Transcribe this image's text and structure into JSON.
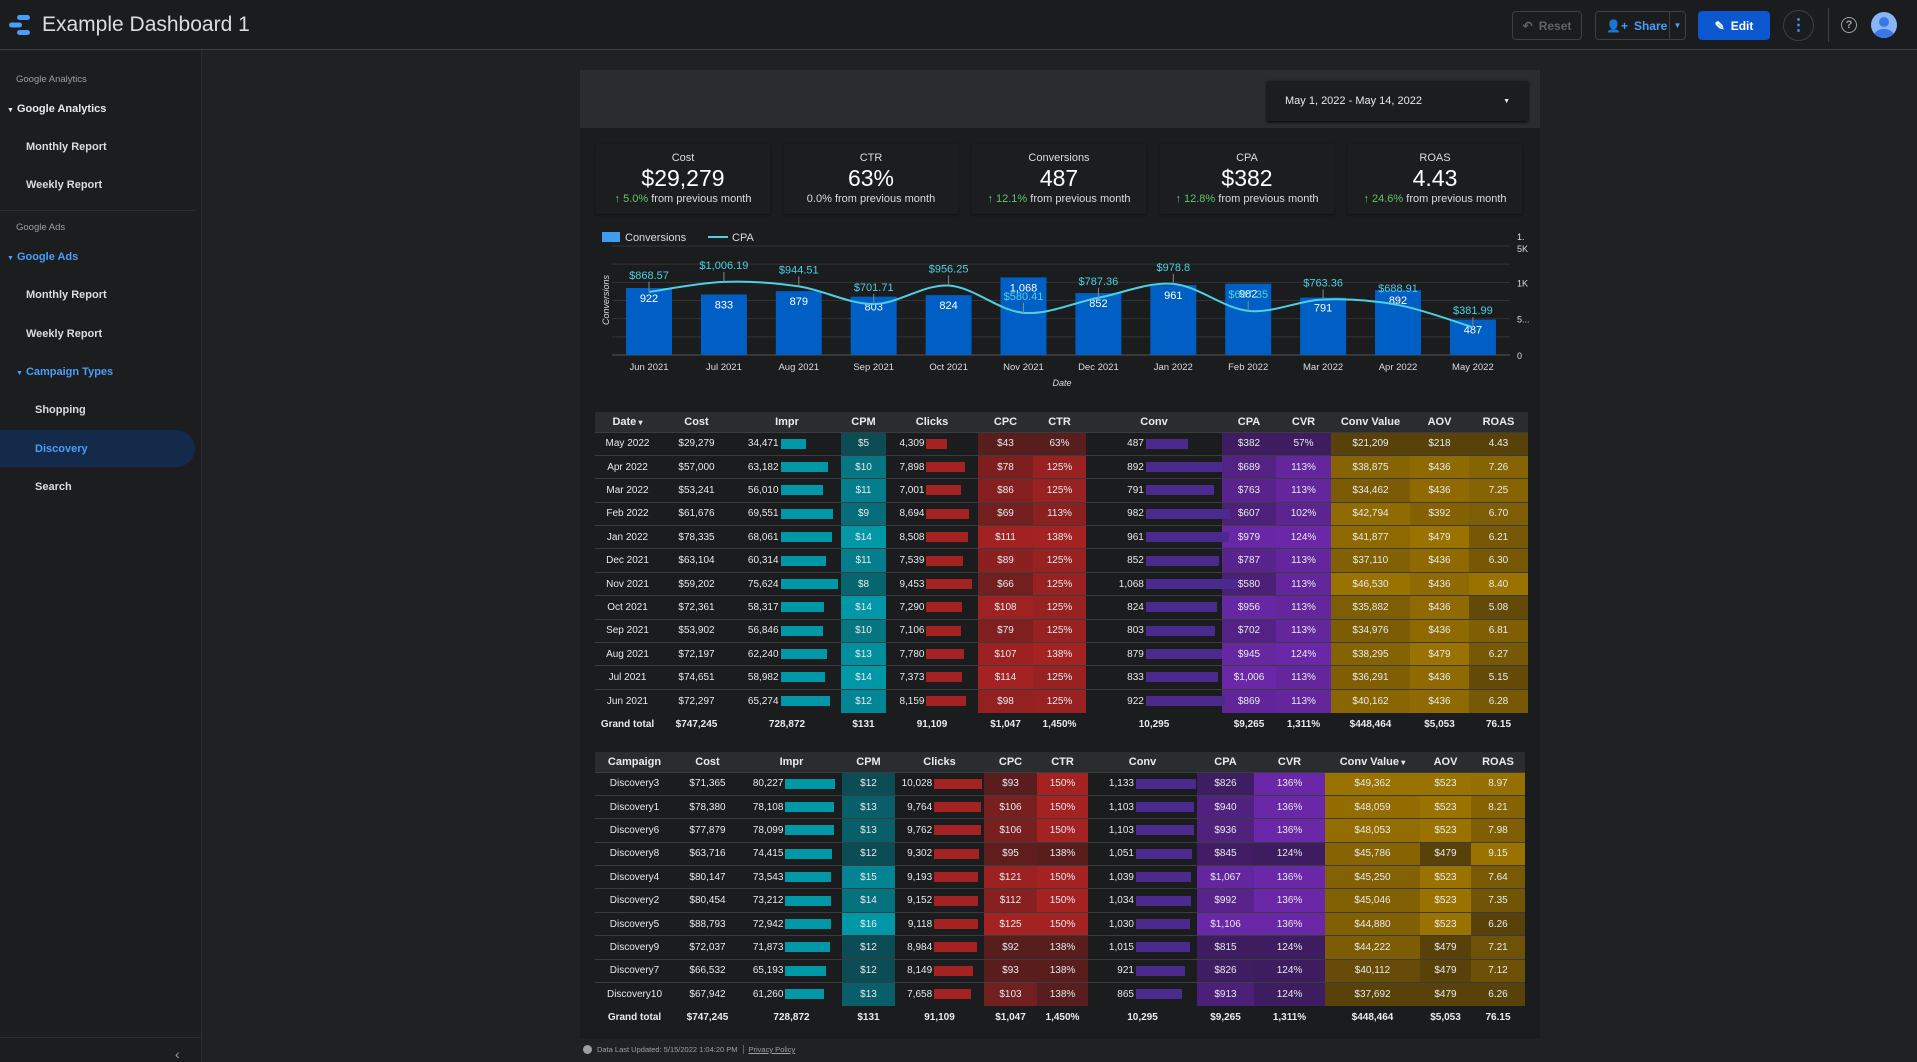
{
  "app": {
    "title": "Example Dashboard 1"
  },
  "toolbar": {
    "reset": "Reset",
    "share": "Share",
    "edit": "Edit"
  },
  "sidebar": {
    "ga_section": "Google Analytics",
    "ga_group": "Google Analytics",
    "ga_monthly": "Monthly Report",
    "ga_weekly": "Weekly Report",
    "ads_section": "Google Ads",
    "ads_group": "Google Ads",
    "ads_monthly": "Monthly Report",
    "ads_weekly": "Weekly Report",
    "campaign_types": "Campaign Types",
    "shopping": "Shopping",
    "discovery": "Discovery",
    "search": "Search"
  },
  "date_range": "May 1, 2022 - May 14, 2022",
  "kpis": [
    {
      "label": "Cost",
      "value": "$29,279",
      "delta": "5.0%",
      "suffix": "from previous month",
      "up": true
    },
    {
      "label": "CTR",
      "value": "63%",
      "delta": "0.0%",
      "suffix": "from previous month",
      "up": false
    },
    {
      "label": "Conversions",
      "value": "487",
      "delta": "12.1%",
      "suffix": "from previous month",
      "up": true
    },
    {
      "label": "CPA",
      "value": "$382",
      "delta": "12.8%",
      "suffix": "from previous month",
      "up": true
    },
    {
      "label": "ROAS",
      "value": "4.43",
      "delta": "24.6%",
      "suffix": "from previous month",
      "up": true
    }
  ],
  "chart_data": {
    "type": "bar",
    "categories": [
      "Jun 2021",
      "Jul 2021",
      "Aug 2021",
      "Sep 2021",
      "Oct 2021",
      "Nov 2021",
      "Dec 2021",
      "Jan 2022",
      "Feb 2022",
      "Mar 2022",
      "Apr 2022",
      "May 2022"
    ],
    "series": [
      {
        "name": "Conversions",
        "type": "bar",
        "values": [
          922,
          833,
          879,
          803,
          824,
          1068,
          852,
          961,
          982,
          791,
          892,
          487
        ],
        "labels": [
          "922",
          "833",
          "879",
          "803",
          "824",
          "1,068",
          "852",
          "961",
          "982",
          "791",
          "892",
          "487"
        ]
      },
      {
        "name": "CPA",
        "type": "line",
        "values": [
          868.57,
          1006.19,
          944.51,
          701.71,
          956.25,
          580.41,
          787.36,
          978.8,
          607.35,
          763.36,
          688.91,
          381.99
        ],
        "labels": [
          "$868.57",
          "$1,006.19",
          "$944.51",
          "$701.71",
          "$956.25",
          "$580.41",
          "$787.36",
          "$978.8",
          "$607.35",
          "$763.36",
          "$688.91",
          "$381.99"
        ]
      }
    ],
    "xlabel": "Date",
    "ylabel": "Conversions",
    "ylim": [
      0,
      1500
    ],
    "yticks": [
      "0",
      "5...",
      "1K",
      "1.\n5K"
    ],
    "colors": {
      "bar": "#005fc4",
      "legend_bar": "#3d9df0",
      "line": "#4dd0e1"
    },
    "legend": "top-left"
  },
  "table_monthly": {
    "headers": [
      "Date",
      "Cost",
      "Impr",
      "CPM",
      "Clicks",
      "CPC",
      "CTR",
      "Conv",
      "CPA",
      "CVR",
      "Conv Value",
      "AOV",
      "ROAS"
    ],
    "sort_col": 0,
    "rows": [
      [
        "May 2022",
        "$29,279",
        "34,471",
        "$5",
        "4,309",
        "$43",
        "63%",
        "487",
        "$382",
        "57%",
        "$21,209",
        "$218",
        "4.43"
      ],
      [
        "Apr 2022",
        "$57,000",
        "63,182",
        "$10",
        "7,898",
        "$78",
        "125%",
        "892",
        "$689",
        "113%",
        "$38,875",
        "$436",
        "7.26"
      ],
      [
        "Mar 2022",
        "$53,241",
        "56,010",
        "$11",
        "7,001",
        "$86",
        "125%",
        "791",
        "$763",
        "113%",
        "$34,462",
        "$436",
        "7.25"
      ],
      [
        "Feb 2022",
        "$61,676",
        "69,551",
        "$9",
        "8,694",
        "$69",
        "113%",
        "982",
        "$607",
        "102%",
        "$42,794",
        "$392",
        "6.70"
      ],
      [
        "Jan 2022",
        "$78,335",
        "68,061",
        "$14",
        "8,508",
        "$111",
        "138%",
        "961",
        "$979",
        "124%",
        "$41,877",
        "$479",
        "6.21"
      ],
      [
        "Dec 2021",
        "$63,104",
        "60,314",
        "$11",
        "7,539",
        "$89",
        "125%",
        "852",
        "$787",
        "113%",
        "$37,110",
        "$436",
        "6.30"
      ],
      [
        "Nov 2021",
        "$59,202",
        "75,624",
        "$8",
        "9,453",
        "$66",
        "125%",
        "1,068",
        "$580",
        "113%",
        "$46,530",
        "$436",
        "8.40"
      ],
      [
        "Oct 2021",
        "$72,361",
        "58,317",
        "$14",
        "7,290",
        "$108",
        "125%",
        "824",
        "$956",
        "113%",
        "$35,882",
        "$436",
        "5.08"
      ],
      [
        "Sep 2021",
        "$53,902",
        "56,846",
        "$10",
        "7,106",
        "$79",
        "125%",
        "803",
        "$702",
        "113%",
        "$34,976",
        "$436",
        "6.81"
      ],
      [
        "Aug 2021",
        "$72,197",
        "62,240",
        "$13",
        "7,780",
        "$107",
        "138%",
        "879",
        "$945",
        "124%",
        "$38,295",
        "$479",
        "6.27"
      ],
      [
        "Jul 2021",
        "$74,651",
        "58,982",
        "$14",
        "7,373",
        "$114",
        "125%",
        "833",
        "$1,006",
        "113%",
        "$36,291",
        "$436",
        "5.15"
      ],
      [
        "Jun 2021",
        "$72,297",
        "65,274",
        "$12",
        "8,159",
        "$98",
        "125%",
        "922",
        "$869",
        "113%",
        "$40,162",
        "$436",
        "6.28"
      ]
    ],
    "total": [
      "Grand total",
      "$747,245",
      "728,872",
      "$131",
      "91,109",
      "$1,047",
      "1,450%",
      "10,295",
      "$9,265",
      "1,311%",
      "$448,464",
      "$5,053",
      "76.15"
    ]
  },
  "table_campaign": {
    "headers": [
      "Campaign",
      "Cost",
      "Impr",
      "CPM",
      "Clicks",
      "CPC",
      "CTR",
      "Conv",
      "CPA",
      "CVR",
      "Conv Value",
      "AOV",
      "ROAS"
    ],
    "sort_col": 10,
    "rows": [
      [
        "Discovery3",
        "$71,365",
        "80,227",
        "$12",
        "10,028",
        "$93",
        "150%",
        "1,133",
        "$826",
        "136%",
        "$49,362",
        "$523",
        "8.97"
      ],
      [
        "Discovery1",
        "$78,380",
        "78,108",
        "$13",
        "9,764",
        "$106",
        "150%",
        "1,103",
        "$940",
        "136%",
        "$48,059",
        "$523",
        "8.21"
      ],
      [
        "Discovery6",
        "$77,879",
        "78,099",
        "$13",
        "9,762",
        "$106",
        "150%",
        "1,103",
        "$936",
        "136%",
        "$48,053",
        "$523",
        "7.98"
      ],
      [
        "Discovery8",
        "$63,716",
        "74,415",
        "$12",
        "9,302",
        "$95",
        "138%",
        "1,051",
        "$845",
        "124%",
        "$45,786",
        "$479",
        "9.15"
      ],
      [
        "Discovery4",
        "$80,147",
        "73,543",
        "$15",
        "9,193",
        "$121",
        "150%",
        "1,039",
        "$1,067",
        "136%",
        "$45,250",
        "$523",
        "7.64"
      ],
      [
        "Discovery2",
        "$80,454",
        "73,212",
        "$14",
        "9,152",
        "$112",
        "150%",
        "1,034",
        "$992",
        "136%",
        "$45,046",
        "$523",
        "7.35"
      ],
      [
        "Discovery5",
        "$88,793",
        "72,942",
        "$16",
        "9,118",
        "$125",
        "150%",
        "1,030",
        "$1,106",
        "136%",
        "$44,880",
        "$523",
        "6.26"
      ],
      [
        "Discovery9",
        "$72,037",
        "71,873",
        "$12",
        "8,984",
        "$92",
        "138%",
        "1,015",
        "$815",
        "124%",
        "$44,222",
        "$479",
        "7.21"
      ],
      [
        "Discovery7",
        "$66,532",
        "65,193",
        "$12",
        "8,149",
        "$93",
        "138%",
        "921",
        "$826",
        "124%",
        "$40,112",
        "$479",
        "7.12"
      ],
      [
        "Discovery10",
        "$67,942",
        "61,260",
        "$13",
        "7,658",
        "$103",
        "138%",
        "865",
        "$913",
        "124%",
        "$37,692",
        "$479",
        "6.26"
      ]
    ],
    "total": [
      "Grand total",
      "$747,245",
      "728,872",
      "$131",
      "91,109",
      "$1,047",
      "1,450%",
      "10,295",
      "$9,265",
      "1,311%",
      "$448,464",
      "$5,053",
      "76.15"
    ]
  },
  "colors": {
    "teal": "#0097a7",
    "red": "#a52222",
    "purple": "#6a28a8",
    "gold": "#9a7200",
    "bar_purple": "#4a2a8c",
    "accent": "#4a9df8"
  },
  "footer": {
    "updated": "Data Last Updated: 5/15/2022 1:04:20 PM",
    "privacy": "Privacy Policy"
  }
}
